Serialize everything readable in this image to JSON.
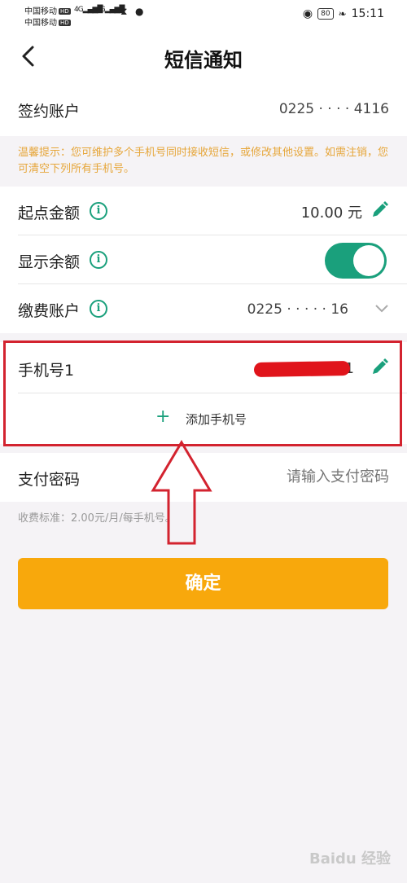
{
  "status_bar": {
    "carrier1": "中国移动",
    "carrier2": "中国移动",
    "hd_badge": "HD",
    "network": "4G",
    "battery": "80",
    "time": "15:11"
  },
  "header": {
    "back_icon": "chevron-left-icon",
    "title": "短信通知"
  },
  "account": {
    "label": "签约账户",
    "value": "0225 · · · · 4116"
  },
  "tip": {
    "text": "温馨提示：您可维护多个手机号同时接收短信，或修改其他设置。如需注销，您可清空下列所有手机号。"
  },
  "threshold": {
    "label": "起点金额",
    "value": "10.00 元",
    "info_icon": "info-icon",
    "edit_icon": "pencil-icon"
  },
  "show_balance": {
    "label": "显示余额",
    "enabled": true
  },
  "fee_account": {
    "label": "缴费账户",
    "value": "0225 · · · · · 16"
  },
  "phone": {
    "label": "手机号1",
    "value_suffix": "1",
    "add_label": "添加手机号"
  },
  "password": {
    "label": "支付密码",
    "placeholder": "请输入支付密码"
  },
  "fee_note": "收费标准：2.00元/月/每手机号。",
  "confirm_label": "确定",
  "watermark": "Baidu 经验",
  "colors": {
    "accent_green": "#1aa07c",
    "tip_orange": "#e6a63a",
    "button_orange": "#f8a80c",
    "annotation_red": "#d3232f"
  }
}
